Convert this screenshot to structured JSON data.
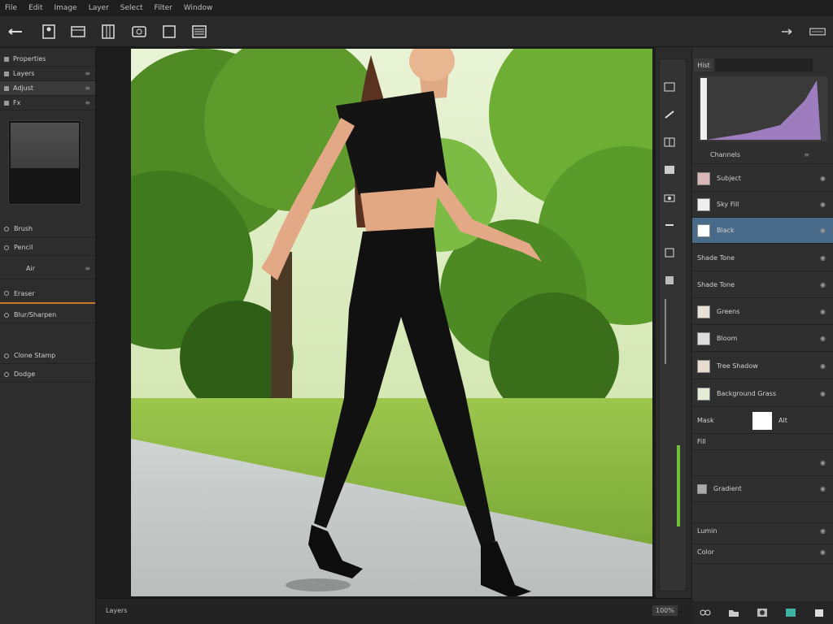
{
  "menu": {
    "items": [
      "File",
      "Edit",
      "Image",
      "Layer",
      "Select",
      "Filter",
      "Window"
    ]
  },
  "left_panel": {
    "rows": [
      {
        "label": "Properties",
        "right": "≡"
      },
      {
        "label": "Layers",
        "right": "≡"
      },
      {
        "label": "Adjust",
        "right": "≡"
      },
      {
        "label": "Fx",
        "right": "≡"
      }
    ],
    "groups": [
      {
        "label": "Brush",
        "right": ""
      },
      {
        "label": "Pencil",
        "right": ""
      },
      {
        "label": "Air",
        "right": "≡"
      },
      {
        "label": "Eraser",
        "right": ""
      },
      {
        "label": "Blur/Sharpen",
        "right": ""
      },
      {
        "label": "Clone Stamp",
        "right": ""
      },
      {
        "label": "Dodge",
        "right": ""
      }
    ]
  },
  "right_panel": {
    "header_tab": "Hist",
    "section": "Channels",
    "layers": [
      {
        "name": "Subject",
        "eye": "eye"
      },
      {
        "name": "Sky Fill",
        "eye": "eye"
      },
      {
        "name": "Black",
        "eye": "eye"
      },
      {
        "name": "Shade Tone",
        "eye": "eye"
      },
      {
        "name": "Shade Tone",
        "eye": "eye"
      },
      {
        "name": "Greens",
        "eye": "eye"
      },
      {
        "name": "Bloom",
        "eye": "eye"
      },
      {
        "name": "Tree Shadow",
        "eye": "eye"
      },
      {
        "name": "Background Grass",
        "eye": "eye"
      }
    ],
    "extra": [
      {
        "name": "Mask",
        "mid": "Alt",
        "eye": ""
      },
      {
        "name": "Fill",
        "mid": "",
        "eye": ""
      },
      {
        "name": "",
        "mid": "",
        "eye": "eye"
      },
      {
        "name": "Gradient",
        "mid": "",
        "eye": "eye"
      },
      {
        "name": "",
        "mid": "",
        "eye": ""
      },
      {
        "name": "Lumin",
        "mid": "",
        "eye": "eye"
      },
      {
        "name": "Color",
        "mid": "",
        "eye": "eye"
      }
    ]
  },
  "status": {
    "left": "Layers",
    "right": "100%"
  },
  "colors": {
    "accent": "#4a6a8a",
    "highlight_bar": "#c77a2c",
    "green_slider": "#6fbf3a"
  }
}
